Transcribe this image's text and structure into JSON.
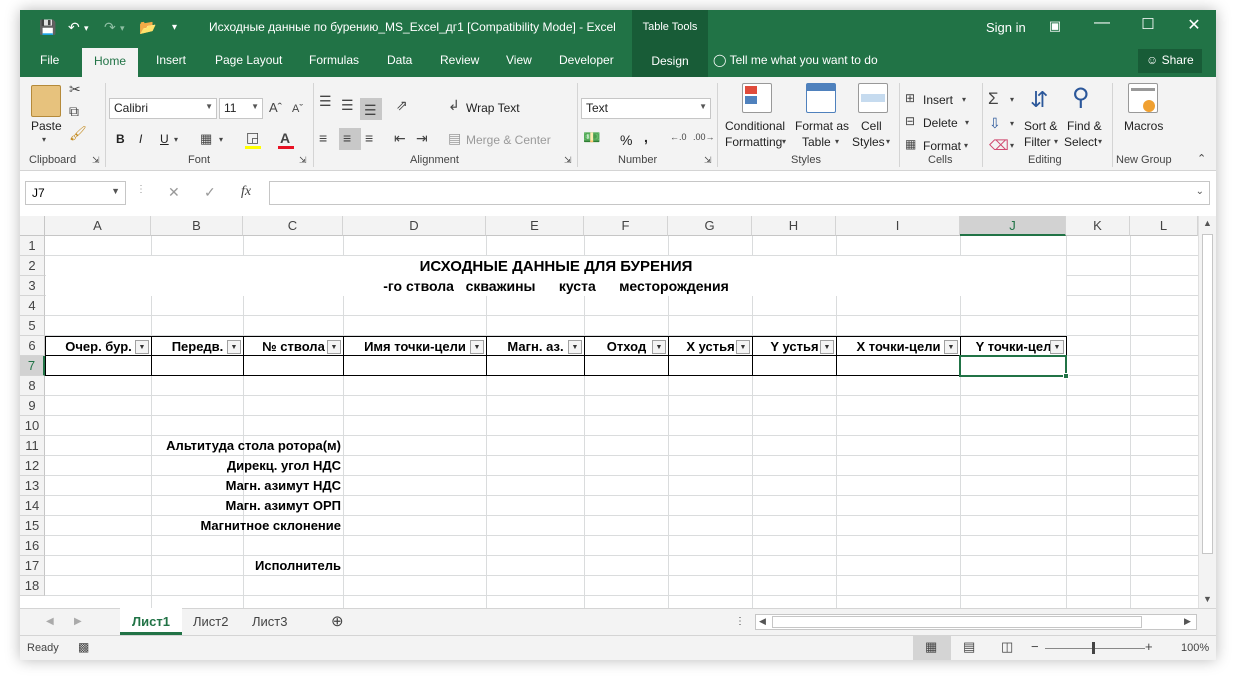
{
  "window": {
    "title": "Исходные данные по бурению_MS_Excel_дг1  [Compatibility Mode] - Excel",
    "table_tools": "Table Tools",
    "sign_in": "Sign in"
  },
  "tabs": [
    "File",
    "Home",
    "Insert",
    "Page Layout",
    "Formulas",
    "Data",
    "Review",
    "View",
    "Developer",
    "Design"
  ],
  "active_tab": "Home",
  "tell_me": "Tell me what you want to do",
  "share": "Share",
  "ribbon": {
    "clipboard": {
      "label": "Clipboard",
      "paste": "Paste"
    },
    "font": {
      "label": "Font",
      "name": "Calibri",
      "size": "11",
      "bold": "B",
      "italic": "I",
      "underline": "U"
    },
    "alignment": {
      "label": "Alignment",
      "wrap": "Wrap Text",
      "merge": "Merge & Center"
    },
    "number": {
      "label": "Number",
      "format": "Text",
      "percent": "%",
      "comma": ","
    },
    "styles": {
      "label": "Styles",
      "conditional_1": "Conditional",
      "conditional_2": "Formatting",
      "format_table_1": "Format as",
      "format_table_2": "Table",
      "cell_styles_1": "Cell",
      "cell_styles_2": "Styles"
    },
    "cells": {
      "label": "Cells",
      "insert": "Insert",
      "delete": "Delete",
      "format": "Format"
    },
    "editing": {
      "label": "Editing",
      "sort_1": "Sort &",
      "sort_2": "Filter",
      "find_1": "Find &",
      "find_2": "Select"
    },
    "new_group": {
      "label": "New Group",
      "macros": "Macros"
    }
  },
  "formula_bar": {
    "name_box": "J7",
    "fx": "fx",
    "value": ""
  },
  "columns": [
    "A",
    "B",
    "C",
    "D",
    "E",
    "F",
    "G",
    "H",
    "I",
    "J",
    "K",
    "L"
  ],
  "rows": [
    "1",
    "2",
    "3",
    "4",
    "5",
    "6",
    "7",
    "8",
    "9",
    "10",
    "11",
    "12",
    "13",
    "14",
    "15",
    "16",
    "17",
    "18"
  ],
  "selected_column": "J",
  "selected_row": "7",
  "sheet": {
    "title": "ИСХОДНЫЕ ДАННЫЕ ДЛЯ БУРЕНИЯ",
    "subtitle": "-го ствола   скважины      куста      месторождения",
    "table_headers": [
      "Очер. бур.",
      "Передв.",
      "№ ствола",
      "Имя точки-цели",
      "Магн. аз.",
      "Отход",
      "X устья",
      "Y устья",
      "X точки-цели",
      "Y точки-цел"
    ],
    "labels": {
      "altitude": "Альтитуда стола ротора(м)",
      "direct_angle": "Дирекц. угол НДС",
      "magn_az_nds": "Магн. азимут НДС",
      "magn_az_orp": "Магн. азимут ОРП",
      "magn_decl": "Магнитное склонение",
      "executor": "Исполнитель"
    }
  },
  "sheet_tabs": [
    "Лист1",
    "Лист2",
    "Лист3"
  ],
  "active_sheet": "Лист1",
  "status": {
    "ready": "Ready",
    "zoom": "100%"
  },
  "colors": {
    "accent": "#217346",
    "dark_accent": "#185c37"
  }
}
